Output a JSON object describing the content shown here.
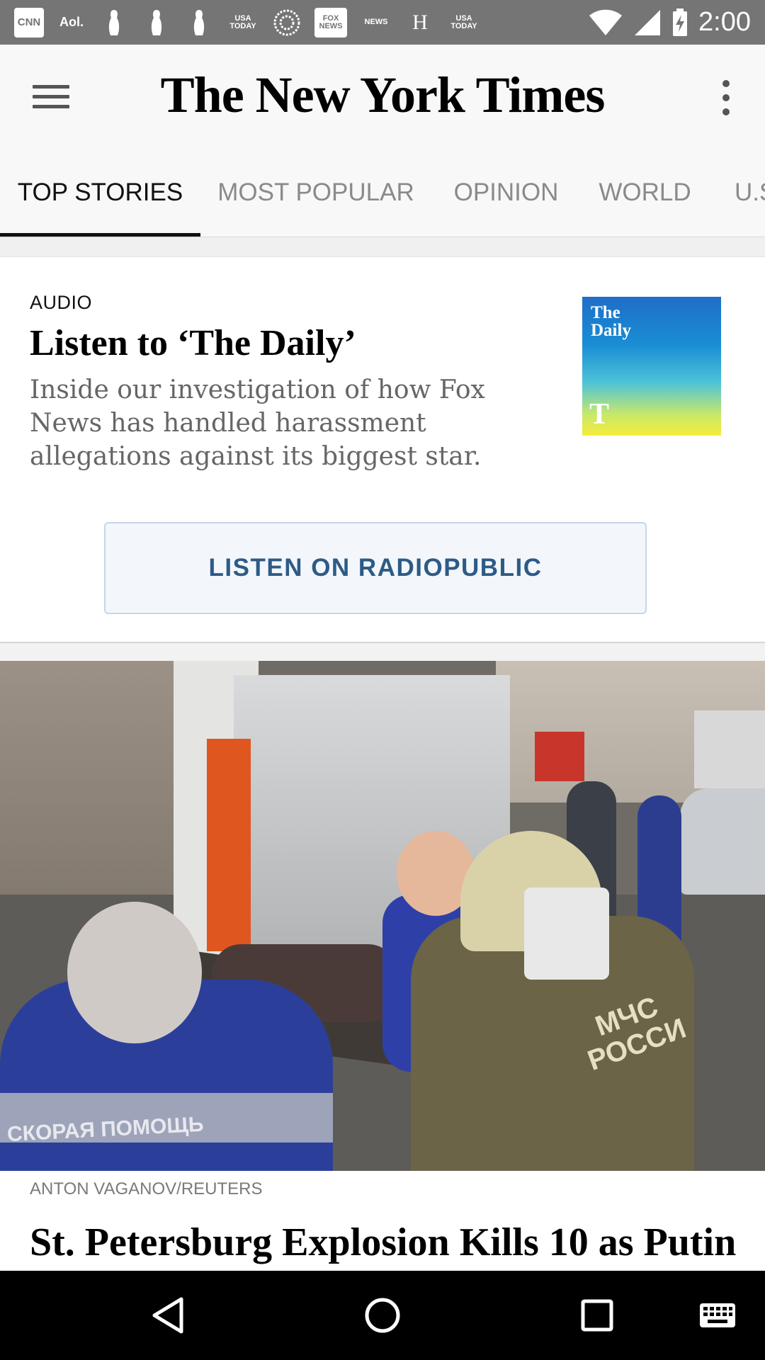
{
  "status_bar": {
    "notifications": [
      {
        "label": "CNN",
        "icon": "cnn-notification-icon"
      },
      {
        "label": "Aol.",
        "icon": "aol-notification-icon"
      },
      {
        "label": "",
        "icon": "bowling-pin-notification-icon"
      },
      {
        "label": "",
        "icon": "bowling-pin-notification-icon"
      },
      {
        "label": "",
        "icon": "bowling-pin-notification-icon"
      },
      {
        "label": "USA TODAY",
        "icon": "usa-today-notification-icon"
      },
      {
        "label": "",
        "icon": "bbc-circle-notification-icon"
      },
      {
        "label": "FOX NEWS",
        "icon": "fox-news-notification-icon"
      },
      {
        "label": "NEWS",
        "icon": "nbc-news-notification-icon"
      },
      {
        "label": "H",
        "icon": "huffpost-notification-icon"
      },
      {
        "label": "USA TODAY",
        "icon": "usa-today-notification-icon"
      }
    ],
    "time": "2:00"
  },
  "header": {
    "logo": "The New York Times",
    "menu_icon": "hamburger-menu-icon",
    "overflow_icon": "more-vert-icon"
  },
  "tabs": [
    {
      "label": "TOP STORIES",
      "active": true
    },
    {
      "label": "MOST POPULAR",
      "active": false
    },
    {
      "label": "OPINION",
      "active": false
    },
    {
      "label": "WORLD",
      "active": false
    },
    {
      "label": "U.S.",
      "active": false
    }
  ],
  "audio_card": {
    "kicker": "AUDIO",
    "title": "Listen to ‘The Daily’",
    "summary": "Inside our investigation of how Fox News has handled harassment allegations against its biggest star.",
    "art_text": "The Daily",
    "art_mark": "T",
    "button_label": "LISTEN ON RADIOPUBLIC"
  },
  "lead_story": {
    "photo_credit": "ANTON VAGANOV/REUTERS",
    "headline": "St. Petersburg Explosion Kills 10 as Putin",
    "jacket_text": "СКОРАЯ ПОМОЩЬ",
    "patch_text": "МЧС РОССИ"
  },
  "colors": {
    "status_bar": "#757575",
    "header_bg": "#f8f8f8",
    "button_text": "#2d5b86",
    "button_bg": "#f3f7fb",
    "nav_bar": "#000000"
  }
}
